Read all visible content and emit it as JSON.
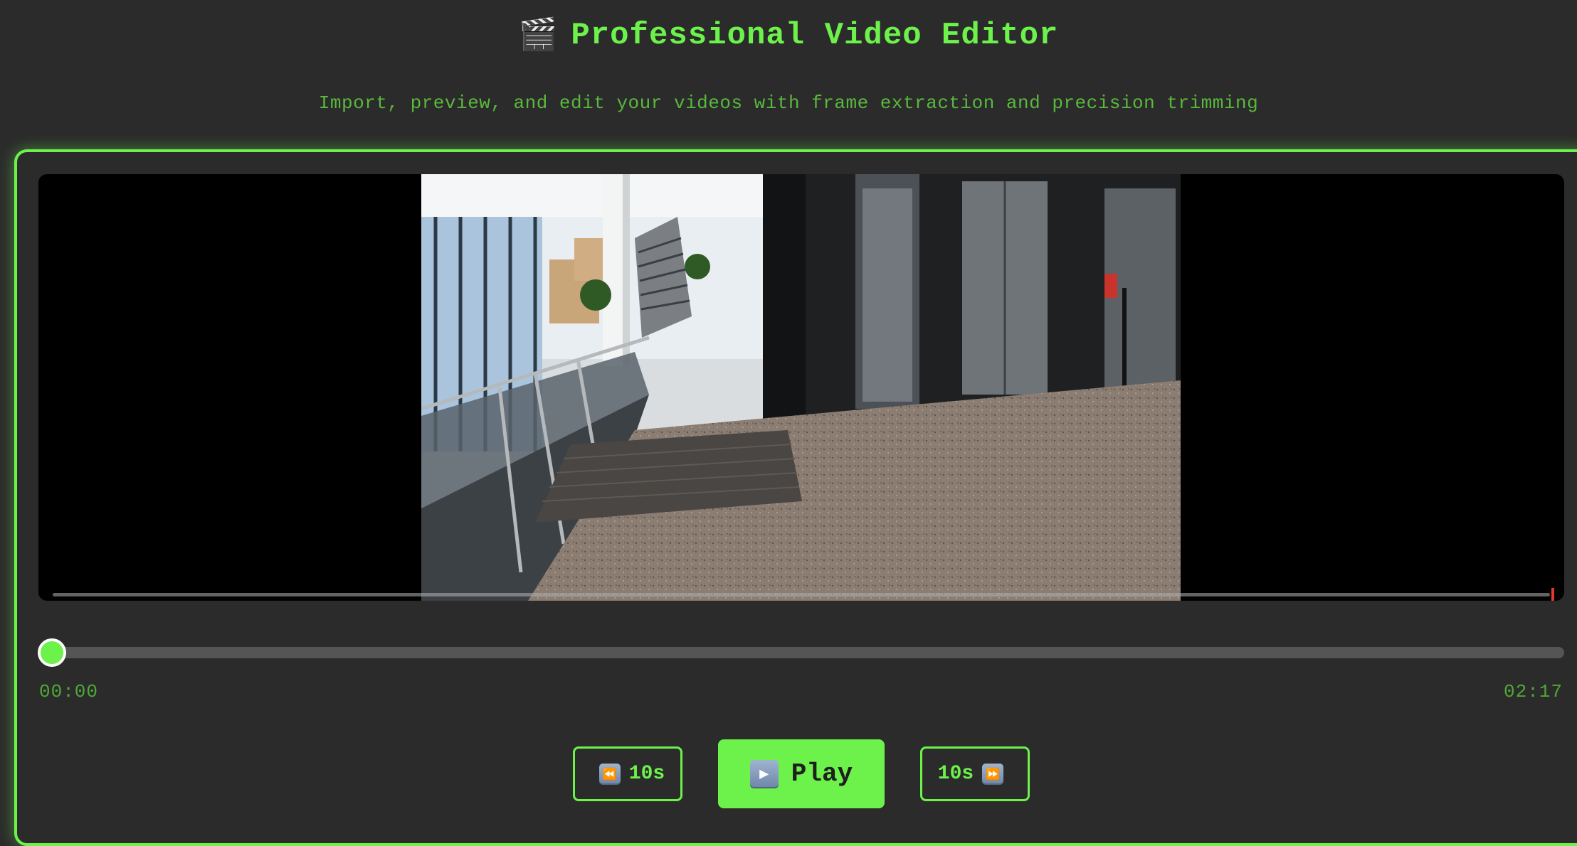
{
  "header": {
    "icon": "clapper-board-icon",
    "title_emoji": "🎬",
    "title": "Professional Video Editor",
    "subtitle": "Import, preview, and edit your videos with frame extraction and precision trimming"
  },
  "player": {
    "progress_fraction": 0.0,
    "current_time": "00:00",
    "total_time": "02:17"
  },
  "controls": {
    "rewind_label": "10s",
    "rewind_icon": "⏪",
    "play_label": "Play",
    "play_icon": "▶",
    "forward_label": "10s",
    "forward_icon": "⏩"
  },
  "colors": {
    "accent": "#6cf24b",
    "background": "#2b2b2b",
    "marker": "#e23a2a"
  }
}
